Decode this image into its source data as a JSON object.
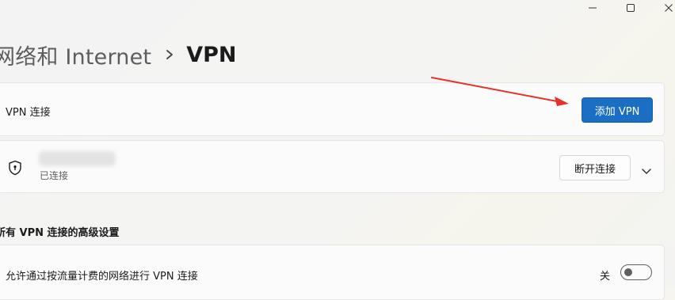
{
  "window_controls": {
    "minimize_icon": "minimize-icon",
    "maximize_icon": "maximize-icon",
    "close_icon": "close-icon"
  },
  "breadcrumb": {
    "parent": "网络和 Internet",
    "separator_icon": "chevron-right-icon",
    "current": "VPN"
  },
  "vpn_connections_card": {
    "label": "VPN 连接",
    "add_button": "添加 VPN"
  },
  "vpn_entry": {
    "icon": "shield-lock-icon",
    "status": "已连接",
    "disconnect_button": "断开连接",
    "expand_icon": "chevron-down-icon"
  },
  "advanced_section": {
    "header": "所有 VPN 连接的高级设置",
    "metered_row": {
      "label": "允许通过按流量计费的网络进行 VPN 连接",
      "toggle_state_label": "关",
      "toggle_on": false
    }
  },
  "annotation": {
    "arrow_color": "#e8312a"
  },
  "colors": {
    "accent": "#1a6fc4"
  }
}
